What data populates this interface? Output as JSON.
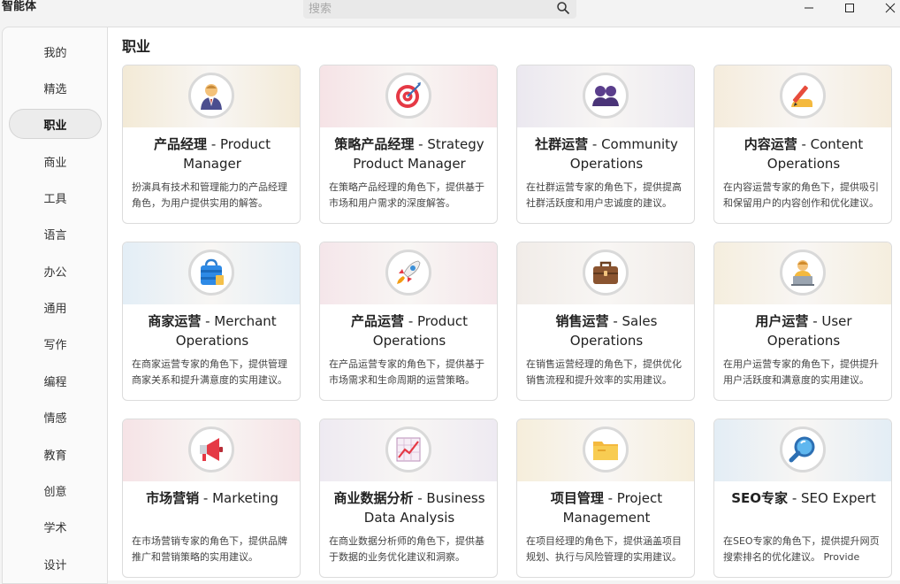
{
  "app": {
    "title": "智能体"
  },
  "search": {
    "placeholder": "搜索"
  },
  "sidebar": {
    "items": [
      {
        "label": "我的"
      },
      {
        "label": "精选"
      },
      {
        "label": "职业"
      },
      {
        "label": "商业"
      },
      {
        "label": "工具"
      },
      {
        "label": "语言"
      },
      {
        "label": "办公"
      },
      {
        "label": "通用"
      },
      {
        "label": "写作"
      },
      {
        "label": "编程"
      },
      {
        "label": "情感"
      },
      {
        "label": "教育"
      },
      {
        "label": "创意"
      },
      {
        "label": "学术"
      },
      {
        "label": "设计"
      }
    ],
    "active": "职业"
  },
  "main": {
    "section_title": "职业",
    "cards": [
      {
        "title_cn": "产品经理",
        "title_en": " - Product Manager",
        "desc": "扮演具有技术和管理能力的产品经理角色，为用户提供实用的解答。",
        "icon": "manager-icon",
        "band": "#f3ead6"
      },
      {
        "title_cn": "策略产品经理",
        "title_en": " - Strategy Product Manager",
        "desc": "在策略产品经理的角色下，提供基于市场和用户需求的深度解答。",
        "icon": "target-icon",
        "band": "#f6e3e6"
      },
      {
        "title_cn": "社群运营",
        "title_en": " - Community Operations",
        "desc": "在社群运营专家的角色下，提供提高社群活跃度和用户忠诚度的建议。",
        "icon": "people-icon",
        "band": "#ebe8f0"
      },
      {
        "title_cn": "内容运营",
        "title_en": " - Content Operations",
        "desc": "在内容运营专家的角色下，提供吸引和保留用户的内容创作和优化建议。",
        "icon": "writing-icon",
        "band": "#f5ecdc"
      },
      {
        "title_cn": "商家运营",
        "title_en": " - Merchant Operations",
        "desc": "在商家运营专家的角色下，提供管理商家关系和提升满意度的实用建议。",
        "icon": "shopping-bag-icon",
        "band": "#e3eef6"
      },
      {
        "title_cn": "产品运营",
        "title_en": " - Product Operations",
        "desc": "在产品运营专家的角色下，提供基于市场需求和生命周期的运营策略。",
        "icon": "rocket-icon",
        "band": "#f5e6ea"
      },
      {
        "title_cn": "销售运营",
        "title_en": " - Sales Operations",
        "desc": "在销售运营经理的角色下，提供优化销售流程和提升效率的实用建议。",
        "icon": "briefcase-icon",
        "band": "#f1ece8"
      },
      {
        "title_cn": "用户运营",
        "title_en": " - User Operations",
        "desc": "在用户运营专家的角色下，提供提升用户活跃度和满意度的实用建议。",
        "icon": "user-laptop-icon",
        "band": "#f5eede"
      },
      {
        "title_cn": "市场营销",
        "title_en": " - Marketing",
        "desc": "在市场营销专家的角色下，提供品牌推广和营销策略的实用建议。",
        "icon": "megaphone-icon",
        "band": "#f6e3e6"
      },
      {
        "title_cn": "商业数据分析",
        "title_en": " - Business Data Analysis",
        "desc": "在商业数据分析师的角色下，提供基于数据的业务优化建议和洞察。",
        "icon": "chart-up-icon",
        "band": "#eeeaf2"
      },
      {
        "title_cn": "项目管理",
        "title_en": " - Project Management",
        "desc": "在项目经理的角色下，提供涵盖项目规划、执行与风险管理的实用建议。",
        "icon": "folder-icon",
        "band": "#f6eedb"
      },
      {
        "title_cn": "SEO专家",
        "title_en": " - SEO Expert",
        "desc": "在SEO专家的角色下，提供提升网页搜索排名的优化建议。 Provide",
        "icon": "magnifier-icon",
        "band": "#e3edf5"
      }
    ]
  }
}
